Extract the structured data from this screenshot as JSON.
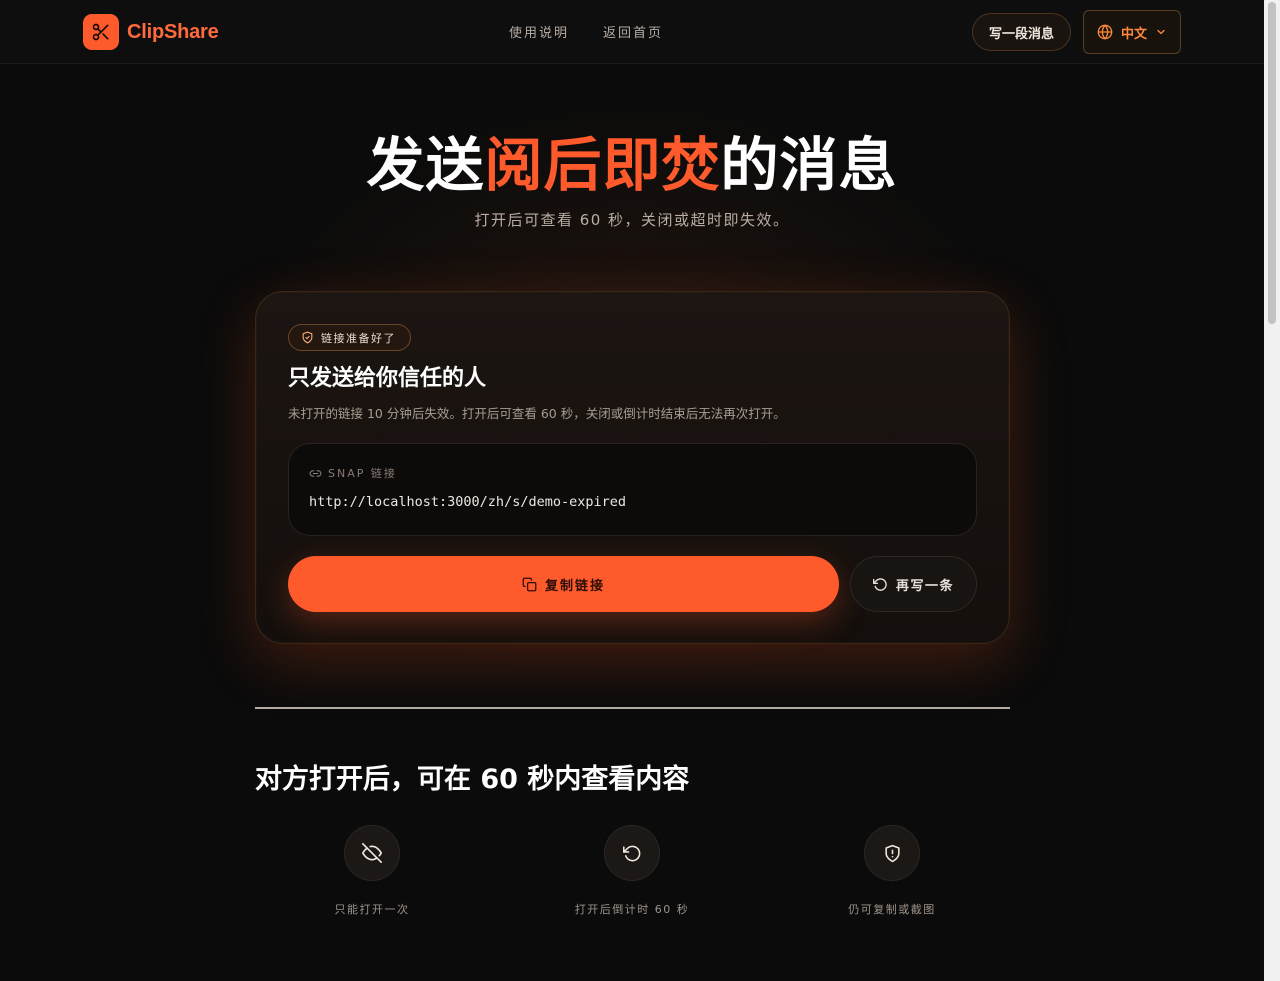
{
  "header": {
    "brand": "ClipShare",
    "nav": [
      "使用说明",
      "返回首页"
    ],
    "write_button": "写一段消息",
    "language": "中文"
  },
  "hero": {
    "title_before": "发送",
    "title_accent": "阅后即焚",
    "title_after": "的消息",
    "subtitle": "打开后可查看 60 秒，关闭或超时即失效。"
  },
  "card": {
    "badge": "链接准备好了",
    "title": "只发送给你信任的人",
    "description": "未打开的链接 10 分钟后失效。打开后可查看 60 秒，关闭或倒计时结束后无法再次打开。",
    "link_label": "SNAP 链接",
    "link_url": "http://localhost:3000/zh/s/demo-expired",
    "copy_button": "复制链接",
    "rewrite_button": "再写一条"
  },
  "section": {
    "title": "对方打开后，可在 60 秒内查看内容",
    "features": [
      {
        "icon": "eye-off-icon",
        "label": "只能打开一次"
      },
      {
        "icon": "rotate-ccw-icon",
        "label": "打开后倒计时 60 秒"
      },
      {
        "icon": "shield-alert-icon",
        "label": "仍可复制或截图"
      }
    ]
  },
  "colors": {
    "accent": "#ff5a2c",
    "background": "#0b0b0b"
  }
}
